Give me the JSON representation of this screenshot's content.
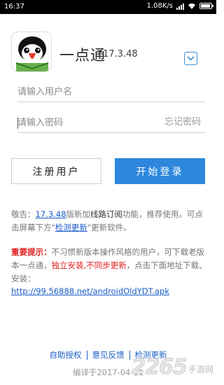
{
  "status_bar": {
    "time": "16:37",
    "network_speed": "1.08K/s",
    "battery_level": 0.8
  },
  "app": {
    "name": "一点通",
    "version": "17.3.48"
  },
  "login": {
    "username_placeholder": "请输入用户名",
    "password_placeholder": "请输入密码",
    "forgot_password": "忘记密码",
    "register_label": "注册用户",
    "login_label": "开始登录"
  },
  "notice": {
    "prefix": "敬告：",
    "version": "17.3.48",
    "text1": "版新加",
    "highlight": "线路订阅",
    "text2": "功能，推荐使用。可点击屏幕下方\"",
    "link": "检测更新",
    "text3": "\"更新软件。"
  },
  "important": {
    "tag": "重要提示：",
    "text1": "不习惯新版本操作风格的用户，可下载老版本一点通，",
    "red": "独立安装,不同步更新",
    "text2": "，点击下面地址下载、安装：",
    "apk_url": "http://99.56888.net/androidOldYDT.apk"
  },
  "footer": {
    "links": [
      "自助授权",
      "意见反馈",
      "检测更新"
    ],
    "compile": "编译于2017-04-11"
  },
  "watermark": {
    "brand": "2265",
    "text": "手游网"
  },
  "colors": {
    "accent": "#2c87dd",
    "link": "#1a5ec7",
    "warning": "#e02020"
  }
}
